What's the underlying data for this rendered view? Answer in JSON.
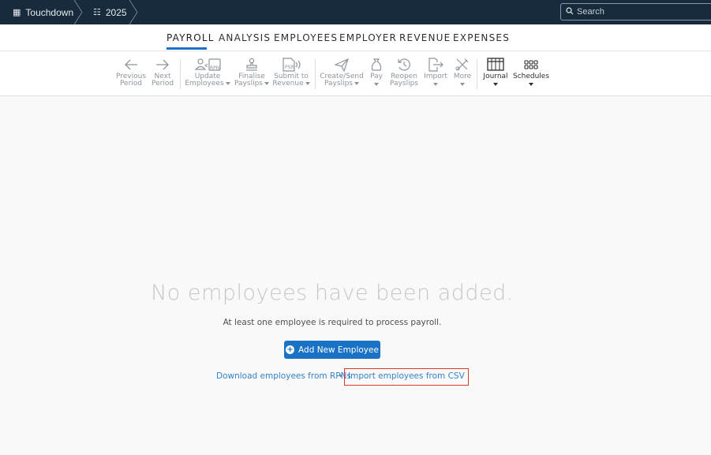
{
  "topbar": {
    "breadcrumbs": [
      {
        "icon": "building-icon",
        "label": "Touchdown"
      },
      {
        "icon": "calendar-icon",
        "label": "2025"
      }
    ],
    "search_placeholder": "Search"
  },
  "main_nav": {
    "tabs": [
      "PAYROLL",
      "ANALYSIS",
      "EMPLOYEES",
      "EMPLOYER",
      "REVENUE",
      "EXPENSES"
    ],
    "active": "PAYROLL"
  },
  "toolbar": {
    "items": [
      {
        "line1": "Previous",
        "line2": "Period"
      },
      {
        "line1": "Next",
        "line2": "Period"
      },
      {
        "line1": "Update",
        "line2": "Employees"
      },
      {
        "line1": "Finalise",
        "line2": "Payslips"
      },
      {
        "line1": "Submit to",
        "line2": "Revenue"
      },
      {
        "line1": "Create/Send",
        "line2": "Payslips"
      },
      {
        "line1": "Pay",
        "line2": ""
      },
      {
        "line1": "Reopen",
        "line2": "Payslips"
      },
      {
        "line1": "Import",
        "line2": ""
      },
      {
        "line1": "More",
        "line2": ""
      },
      {
        "line1": "Journal",
        "line2": ""
      },
      {
        "line1": "Schedules",
        "line2": ""
      }
    ],
    "icon_badges": {
      "rpn": "RPN",
      "psr": "PSR"
    }
  },
  "empty_state": {
    "title": "No employees have been added.",
    "subtitle": "At least one employee is required to process payroll.",
    "add_button": "Add New Employee",
    "link_rpn": "Download employees from RPNs",
    "separator": "•",
    "link_csv": "Import employees from CSV"
  },
  "colors": {
    "topbar_bg": "#182b3c",
    "accent": "#1a73c6",
    "highlight_border": "#d43a2d"
  }
}
